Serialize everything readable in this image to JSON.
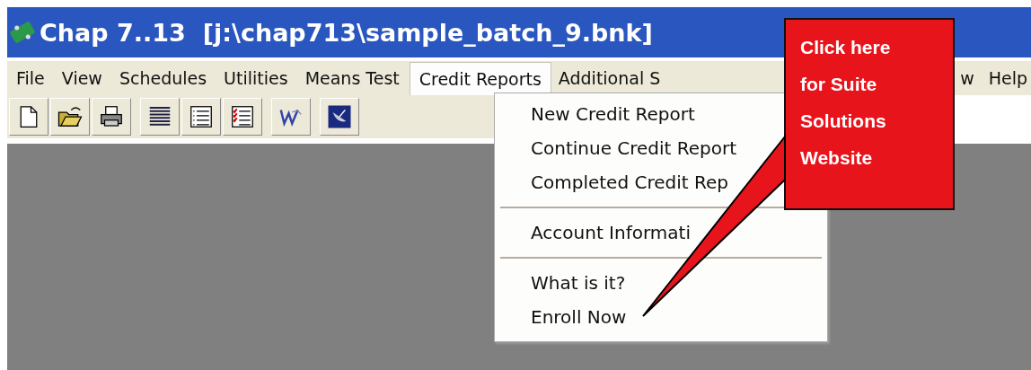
{
  "window": {
    "title": "Chap 7..13  [j:\\chap713\\sample_batch_9.bnk]"
  },
  "menu_bar": [
    {
      "label": "File",
      "selected": false
    },
    {
      "label": "View",
      "selected": false
    },
    {
      "label": "Schedules",
      "selected": false
    },
    {
      "label": "Utilities",
      "selected": false
    },
    {
      "label": "Means Test",
      "selected": false
    },
    {
      "label": "Credit Reports",
      "selected": true
    },
    {
      "label": "Additional S",
      "selected": false
    },
    {
      "label": "w",
      "selected": false
    },
    {
      "label": "Help",
      "selected": false
    }
  ],
  "toolbar": [
    {
      "kind": "new"
    },
    {
      "kind": "open"
    },
    {
      "kind": "print"
    },
    {
      "kind": "lines"
    },
    {
      "kind": "bullets"
    },
    {
      "kind": "checklist"
    },
    {
      "kind": "logo"
    },
    {
      "kind": "dish"
    }
  ],
  "dropdown": [
    {
      "kind": "item",
      "label": "New Credit Report"
    },
    {
      "kind": "item",
      "label": "Continue Credit Report"
    },
    {
      "kind": "item",
      "label": "Completed Credit Rep"
    },
    {
      "kind": "separator"
    },
    {
      "kind": "item",
      "label": "Account Informati"
    },
    {
      "kind": "separator"
    },
    {
      "kind": "item",
      "label": "What is it?"
    },
    {
      "kind": "item",
      "label": "Enroll Now"
    }
  ],
  "callout": {
    "lines": [
      "Click here",
      "for Suite",
      "Solutions",
      "Website"
    ]
  }
}
